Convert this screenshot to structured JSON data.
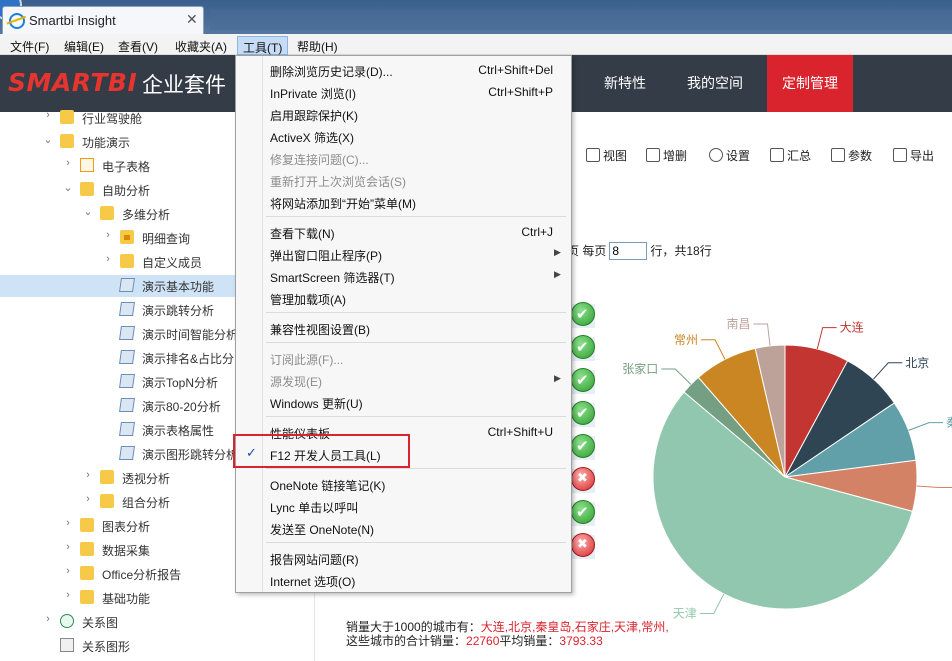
{
  "browser": {
    "tab_title": "Smartbi Insight",
    "tab_close": "✕",
    "menubar": [
      "文件(F)",
      "编辑(E)",
      "查看(V)",
      "收藏夹(A)",
      "工具(T)",
      "帮助(H)"
    ],
    "active_menu_index": 4
  },
  "app": {
    "logo": "SMARTBI",
    "logo_suffix": "企业套件",
    "nav": [
      "新特性",
      "我的空间",
      "定制管理"
    ]
  },
  "tree": [
    {
      "label": "行业驾驶舱",
      "icon": "folder",
      "expanded": false,
      "level": 1
    },
    {
      "label": "功能演示",
      "icon": "folder",
      "expanded": true,
      "level": 1
    },
    {
      "label": "电子表格",
      "icon": "sheet",
      "expanded": false,
      "level": 2
    },
    {
      "label": "自助分析",
      "icon": "folder",
      "expanded": true,
      "level": 2
    },
    {
      "label": "多维分析",
      "icon": "folder",
      "expanded": true,
      "level": 3
    },
    {
      "label": "明细查询",
      "icon": "folder-lock",
      "expanded": false,
      "level": 4
    },
    {
      "label": "自定义成员",
      "icon": "folder",
      "expanded": false,
      "level": 4
    },
    {
      "label": "演示基本功能",
      "icon": "cube",
      "level": 4,
      "selected": true
    },
    {
      "label": "演示跳转分析",
      "icon": "cube",
      "level": 4
    },
    {
      "label": "演示时间智能分析",
      "icon": "cube",
      "level": 4
    },
    {
      "label": "演示排名&占比分",
      "icon": "cube",
      "level": 4
    },
    {
      "label": "演示TopN分析",
      "icon": "cube",
      "level": 4
    },
    {
      "label": "演示80-20分析",
      "icon": "cube",
      "level": 4
    },
    {
      "label": "演示表格属性",
      "icon": "cube",
      "level": 4
    },
    {
      "label": "演示图形跳转分析",
      "icon": "cube",
      "level": 4
    },
    {
      "label": "透视分析",
      "icon": "folder",
      "expanded": false,
      "level": 3
    },
    {
      "label": "组合分析",
      "icon": "folder",
      "expanded": false,
      "level": 3
    },
    {
      "label": "图表分析",
      "icon": "folder",
      "expanded": false,
      "level": 2
    },
    {
      "label": "数据采集",
      "icon": "folder",
      "expanded": false,
      "level": 2
    },
    {
      "label": "Office分析报告",
      "icon": "folder",
      "expanded": false,
      "level": 2
    },
    {
      "label": "基础功能",
      "icon": "folder",
      "expanded": false,
      "level": 2
    },
    {
      "label": "关系图",
      "icon": "v-icon",
      "expanded": false,
      "level": 1
    },
    {
      "label": "关系图形",
      "icon": "relation",
      "level": 1
    }
  ],
  "toolbar": [
    "视图",
    "增删",
    "设置",
    "汇总",
    "参数",
    "导出"
  ],
  "pager": {
    "prefix": "页 每页",
    "page_size": "8",
    "suffix": "行，共18行"
  },
  "status_icons": [
    "ok",
    "ok",
    "ok",
    "ok",
    "ok",
    "no",
    "ok",
    "no"
  ],
  "chart_data": {
    "type": "pie",
    "title": "",
    "series": [
      {
        "name": "大连",
        "value": 7.6,
        "color": "#c23531"
      },
      {
        "name": "北京",
        "value": 7.4,
        "color": "#2f4554"
      },
      {
        "name": "秦皇",
        "value": 7.2,
        "color": "#61a0a8"
      },
      {
        "name": "石",
        "value": 6.0,
        "color": "#d48265"
      },
      {
        "name": "天津",
        "value": 55.0,
        "color": "#91c7ae"
      },
      {
        "name": "张家口",
        "value": 2.4,
        "color": "#749f83"
      },
      {
        "name": "常州",
        "value": 7.5,
        "color": "#ca8622"
      },
      {
        "name": "南昌",
        "value": 3.5,
        "color": "#bda29a"
      }
    ]
  },
  "summary": {
    "line1_prefix": "销量大于1000的城市有：",
    "line1_value": "大连,北京,秦皇岛,石家庄,天津,常州,",
    "line2_prefix": "这些城市的合计销量：",
    "line2_total": "22760",
    "line2_mid": "平均销量：",
    "line2_avg": "3793.33"
  },
  "dropdown": [
    {
      "label": "删除浏览历史记录(D)...",
      "shortcut": "Ctrl+Shift+Del"
    },
    {
      "label": "InPrivate 浏览(I)",
      "shortcut": "Ctrl+Shift+P"
    },
    {
      "label": "启用跟踪保护(K)"
    },
    {
      "label": "ActiveX 筛选(X)"
    },
    {
      "label": "修复连接问题(C)...",
      "disabled": true
    },
    {
      "label": "重新打开上次浏览会话(S)",
      "disabled": true
    },
    {
      "label": "将网站添加到“开始”菜单(M)"
    },
    {
      "sep": true
    },
    {
      "label": "查看下载(N)",
      "shortcut": "Ctrl+J"
    },
    {
      "label": "弹出窗口阻止程序(P)",
      "submenu": true
    },
    {
      "label": "SmartScreen 筛选器(T)",
      "submenu": true
    },
    {
      "label": "管理加载项(A)"
    },
    {
      "sep": true
    },
    {
      "label": "兼容性视图设置(B)"
    },
    {
      "sep": true
    },
    {
      "label": "订阅此源(F)...",
      "disabled": true
    },
    {
      "label": "源发现(E)",
      "disabled": true,
      "submenu": true
    },
    {
      "label": "Windows 更新(U)"
    },
    {
      "sep": true
    },
    {
      "label": "性能仪表板",
      "shortcut": "Ctrl+Shift+U"
    },
    {
      "label": "F12 开发人员工具(L)",
      "checked": true
    },
    {
      "sep": true
    },
    {
      "label": "OneNote 链接笔记(K)"
    },
    {
      "label": "Lync 单击以呼叫"
    },
    {
      "label": "发送至 OneNote(N)"
    },
    {
      "sep": true
    },
    {
      "label": "报告网站问题(R)"
    },
    {
      "label": "Internet 选项(O)"
    }
  ]
}
